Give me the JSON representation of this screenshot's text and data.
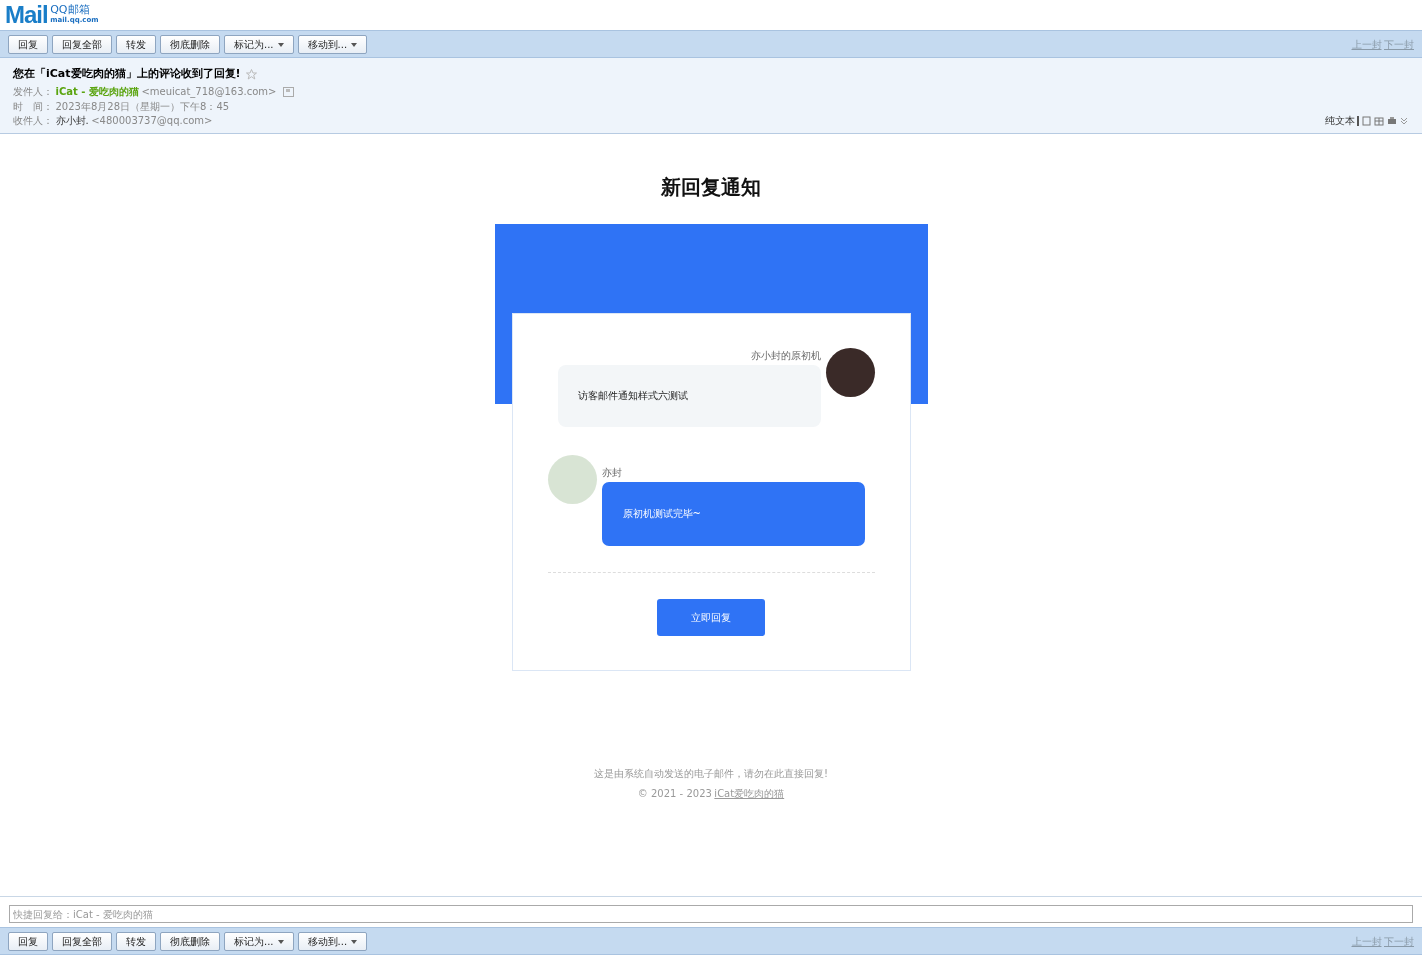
{
  "logo": {
    "text": "Mail",
    "brand": "QQ邮箱",
    "domain": "mail.qq.com"
  },
  "toolbar_top": {
    "buttons": [
      {
        "label": "回复",
        "dropdown": false
      },
      {
        "label": "回复全部",
        "dropdown": false
      },
      {
        "label": "转发",
        "dropdown": false
      },
      {
        "label": "彻底删除",
        "dropdown": false
      },
      {
        "label": "标记为...",
        "dropdown": true
      },
      {
        "label": "移动到...",
        "dropdown": true
      }
    ],
    "nav": [
      "上一封",
      "下一封"
    ]
  },
  "header": {
    "subject": "您在「iCat爱吃肉的猫」上的评论收到了回复!",
    "starred": false,
    "from_label": "发件人：",
    "from_name": "iCat - 爱吃肉的猫",
    "from_email": "<meuicat_718@163.com>",
    "time_label": "时　间：",
    "time": "2023年8月28日（星期一）下午8：45",
    "to_label": "收件人：",
    "to_name": "亦小封.",
    "to_email": "<480003737@qq.com>",
    "plain_text": "纯文本"
  },
  "body": {
    "title": "新回复通知",
    "messages": [
      {
        "kind": "original",
        "author": "亦小封的原初机",
        "text": "访客邮件通知样式六测试"
      },
      {
        "kind": "reply",
        "author": "亦封",
        "text": "原初机测试完毕~"
      }
    ],
    "reply_button": "立即回复",
    "footer_note": "这是由系统自动发送的电子邮件，请勿在此直接回复!",
    "copyright": "© 2021 - 2023",
    "site_link": "iCat爱吃肉的猫"
  },
  "quick_reply": {
    "placeholder": "快捷回复给：iCat - 爱吃肉的猫"
  },
  "toolbar_bottom": {
    "buttons": [
      {
        "label": "回复",
        "dropdown": false
      },
      {
        "label": "回复全部",
        "dropdown": false
      },
      {
        "label": "转发",
        "dropdown": false
      },
      {
        "label": "彻底删除",
        "dropdown": false
      },
      {
        "label": "标记为...",
        "dropdown": true
      },
      {
        "label": "移动到...",
        "dropdown": true
      }
    ],
    "nav": [
      "上一封",
      "下一封"
    ]
  }
}
